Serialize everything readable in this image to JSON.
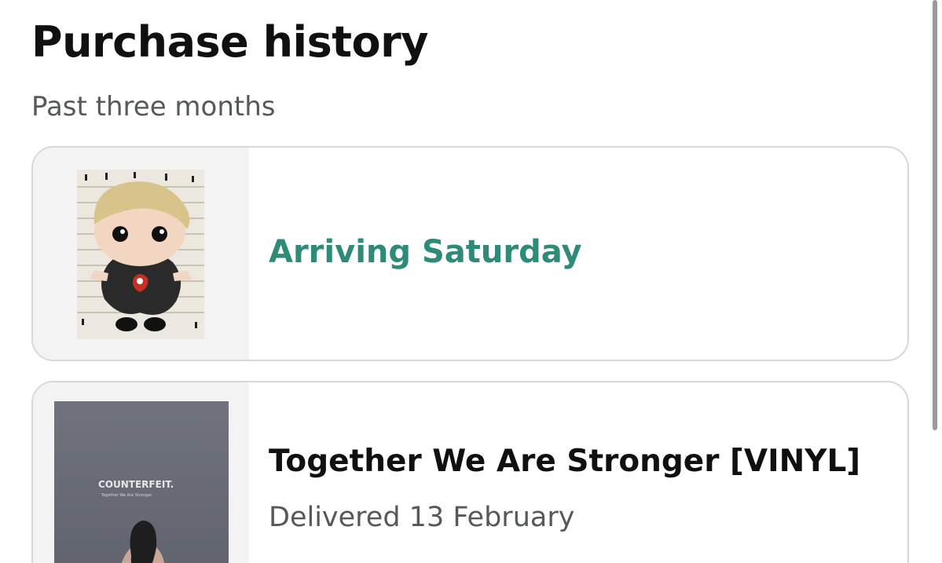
{
  "page": {
    "title": "Purchase history",
    "subtitle": "Past three months"
  },
  "orders": [
    {
      "status": "Arriving Saturday",
      "image": "funko-pop-figure-image",
      "status_color": "#2e8b7a"
    },
    {
      "title": "Together We Are Stronger [VINYL]",
      "status": "Delivered 13 February",
      "image": "album-cover-image",
      "album_art": {
        "band": "COUNTERFEIT.",
        "album": "Together We Are Stronger"
      }
    }
  ],
  "colors": {
    "title": "#0f1111",
    "secondary_text": "#565959",
    "card_border": "#d5d9d9",
    "thumb_background": "#f3f3f3"
  }
}
